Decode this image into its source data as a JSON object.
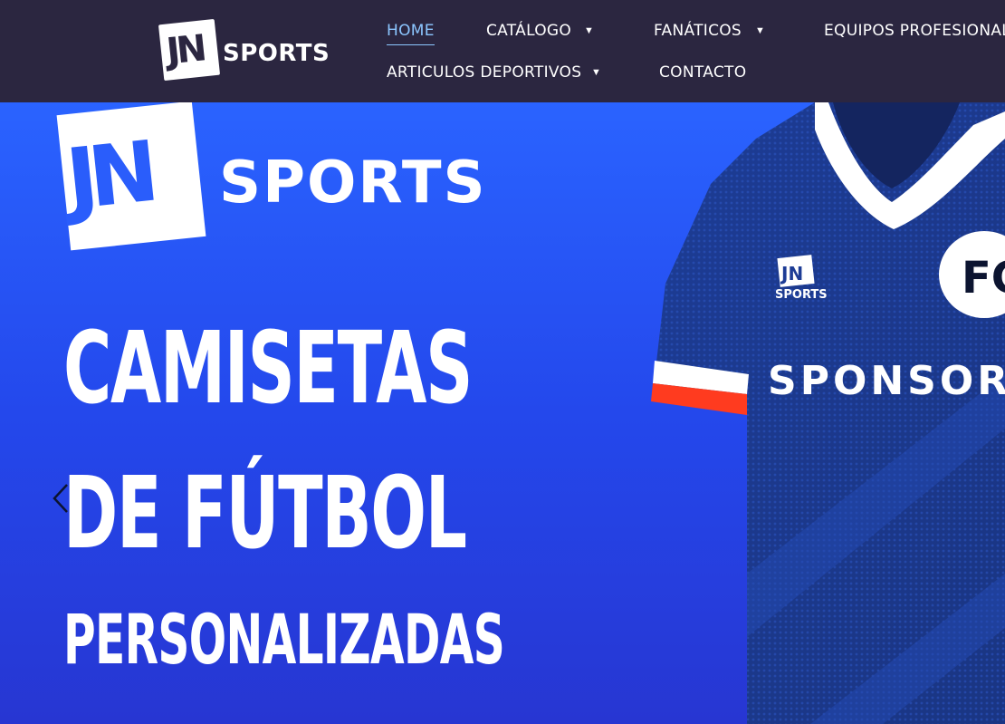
{
  "brand": {
    "mark": "JN",
    "name": "SPORTS"
  },
  "nav": {
    "home": "HOME",
    "catalogo": "CATÁLOGO",
    "fanaticos": "FANÁTICOS",
    "equipos": "EQUIPOS PROFESIONAL",
    "articulos": "ARTICULOS DEPORTIVOS",
    "contacto": "CONTACTO"
  },
  "hero": {
    "brand_mark": "JN",
    "brand_name": "SPORTS",
    "line1": "CAMISETAS",
    "line2": "DE FÚTBOL",
    "line3": "PERSONALIZADAS",
    "jersey_sponsor": "SPONSOR",
    "jersey_badge": "FC",
    "jersey_logo_mark": "JN",
    "jersey_logo_name": "SPORTS"
  },
  "colors": {
    "header_bg": "#2b2640",
    "active_nav": "#8cc6ff",
    "hero_blue": "#2448ec",
    "jersey_navy": "#1b3a8c"
  }
}
